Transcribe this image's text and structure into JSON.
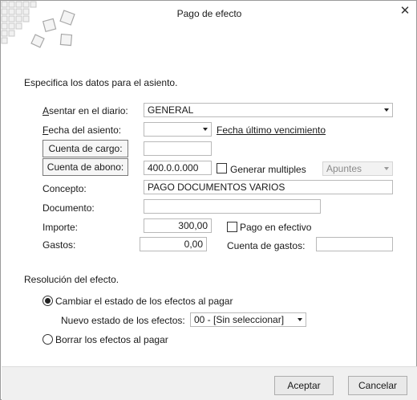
{
  "window": {
    "title": "Pago de efecto",
    "close_symbol": "✕"
  },
  "intro": "Especifica los datos para el asiento.",
  "form": {
    "diario": {
      "label": "Asentar en el diario:",
      "value": "GENERAL"
    },
    "fecha": {
      "label": "Fecha del asiento:",
      "value": "",
      "link": "Fecha último vencimiento"
    },
    "cuenta_cargo": {
      "button": "Cuenta de cargo:",
      "value": ""
    },
    "cuenta_abono": {
      "button": "Cuenta de abono:",
      "value": "400.0.0.000"
    },
    "generar": {
      "label": "Generar multiples",
      "checked": false,
      "select_value": "Apuntes"
    },
    "concepto": {
      "label": "Concepto:",
      "value": "PAGO DOCUMENTOS VARIOS"
    },
    "documento": {
      "label": "Documento:",
      "value": ""
    },
    "importe": {
      "label": "Importe:",
      "value": "300,00"
    },
    "pago_efectivo": {
      "label": "Pago en efectivo",
      "checked": false
    },
    "gastos": {
      "label": "Gastos:",
      "value": "0,00"
    },
    "cuenta_gastos": {
      "label": "Cuenta de gastos:",
      "value": ""
    }
  },
  "resolucion": {
    "title": "Resolución del efecto.",
    "option1": {
      "label": "Cambiar el estado de los efectos al pagar",
      "selected": true
    },
    "nuevo_estado": {
      "label": "Nuevo estado de los efectos:",
      "value": "00 - [Sin seleccionar]"
    },
    "option2": {
      "label": "Borrar los efectos al pagar",
      "selected": false
    }
  },
  "footer": {
    "accept": "Aceptar",
    "cancel": "Cancelar"
  }
}
